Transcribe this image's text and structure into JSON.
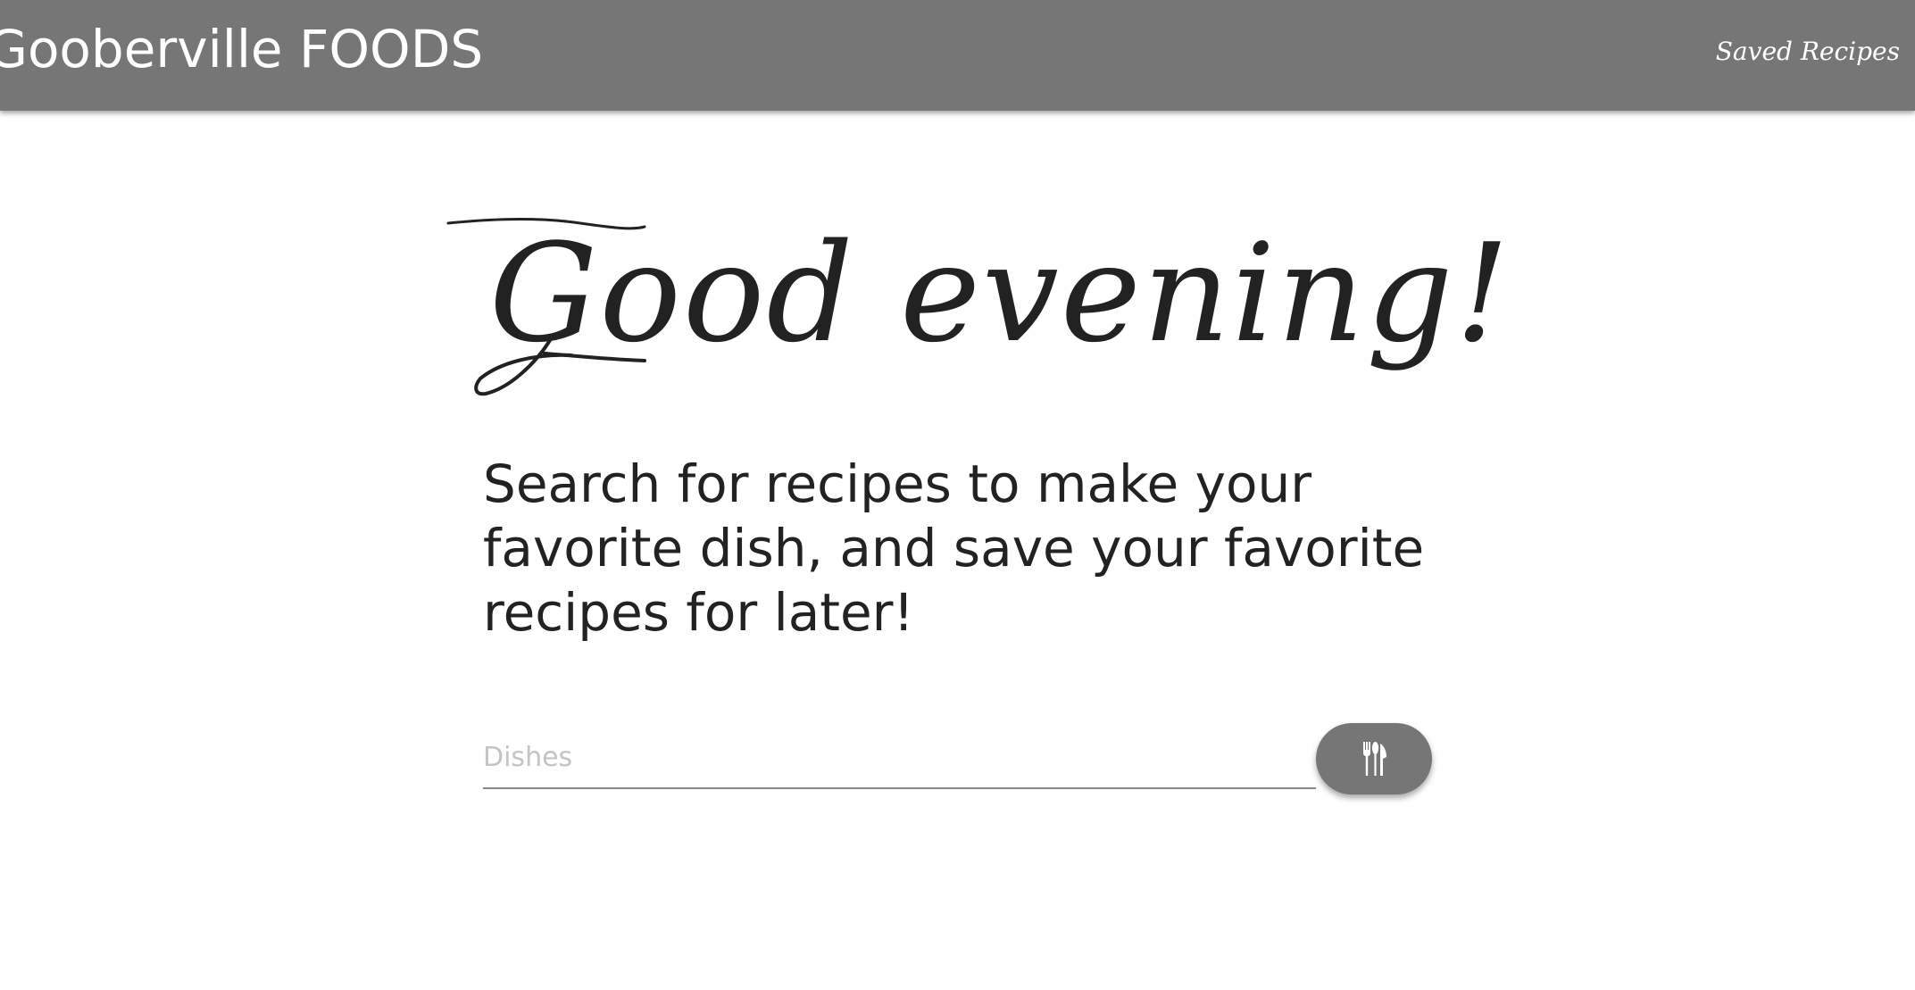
{
  "header": {
    "brand": "Gooberville FOODS",
    "nav_saved_recipes": "Saved Recipes"
  },
  "main": {
    "greeting": "Good evening!",
    "subtitle": "Search for recipes to make your favorite dish, and save your favorite recipes for later!",
    "search": {
      "placeholder": "Dishes",
      "value": "",
      "button_icon": "utensils-icon"
    }
  },
  "colors": {
    "navbar": "#767676",
    "button": "#767676",
    "text": "#222222",
    "placeholder": "#c4c4c4"
  }
}
